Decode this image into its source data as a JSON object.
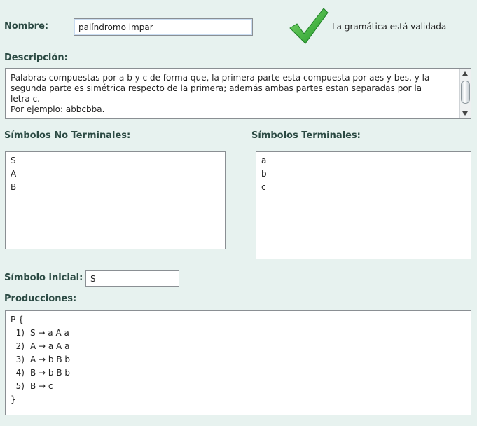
{
  "nombre": {
    "label": "Nombre:",
    "value": "palíndromo impar"
  },
  "status": {
    "text": "La gramática está validada",
    "color": "#3aaa3a",
    "icon": "checkmark-icon"
  },
  "descripcion": {
    "label": "Descripción:",
    "lines": [
      "Palabras compuestas por a b y c de forma que, la primera parte esta compuesta por aes y bes, y la",
      "segunda parte es simétrica respecto de la primera; además ambas partes estan separadas por la",
      "letra c.",
      "Por ejemplo: abbcbba."
    ]
  },
  "no_terminales": {
    "label": "Símbolos No Terminales:",
    "items": [
      "S",
      "A",
      "B"
    ]
  },
  "terminales": {
    "label": "Símbolos Terminales:",
    "items": [
      "a",
      "b",
      "c"
    ]
  },
  "simbolo_inicial": {
    "label": "Símbolo inicial:",
    "value": "S"
  },
  "producciones": {
    "label": "Producciones:",
    "open": "P {",
    "close": "}",
    "rules": [
      {
        "num": "1)",
        "rule": "S → a A a"
      },
      {
        "num": "2)",
        "rule": "A → a A a"
      },
      {
        "num": "3)",
        "rule": "A → b B b"
      },
      {
        "num": "4)",
        "rule": "B → b B b"
      },
      {
        "num": "5)",
        "rule": "B → c"
      }
    ]
  }
}
